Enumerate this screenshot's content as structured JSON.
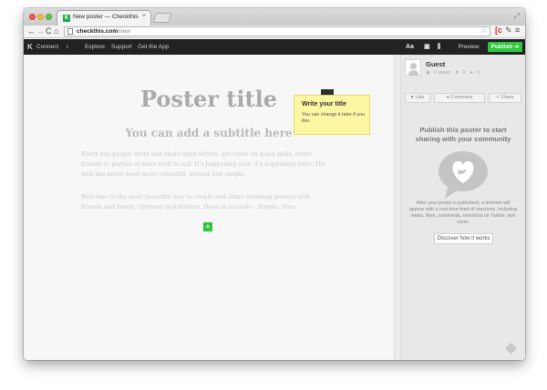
{
  "browser": {
    "tab_title": "New poster — Checkthis",
    "url_host": "checkthis.com",
    "url_path": "/new"
  },
  "appbar": {
    "connect": "Connect",
    "explore": "Explore",
    "support": "Support",
    "get_app": "Get the App",
    "font_tool": "Aa",
    "preview": "Preview",
    "publish": "Publish ➔"
  },
  "poster": {
    "title": "Poster title",
    "subtitle": "You can add a subtitle here",
    "body_1": "Every day people write and share open letters, get votes on quick polls, invite friends to parties or have stuff to sell. It's happening now, it's happening here. The web has never been more colourful, instant and simple.",
    "body_2": "Welcome to the most beautiful way to create and share stunning posters with friends and family. Optional registration. Done in seconds - Simple. Free.",
    "add_button": "+"
  },
  "tooltip": {
    "title": "Write your title",
    "text": "You can change it later if you like."
  },
  "sidebar": {
    "user_name": "Guest",
    "views": "0 views",
    "likes": "0",
    "comments": "0",
    "like_label": "Like",
    "comment_label": "Comment",
    "share_label": "Share",
    "publish_heading": "Publish this poster to start sharing with your community",
    "publish_desc": "After your poster is published, a timeline will appear with a real-time feed of reactions, including views, likes, comments, mentions on Twitter, and more.",
    "discover_label": "Discover how it works"
  },
  "colors": {
    "publish_green": "#2ec63d",
    "appbar_bg": "#222222",
    "tooltip_bg": "#fdf6a3"
  }
}
